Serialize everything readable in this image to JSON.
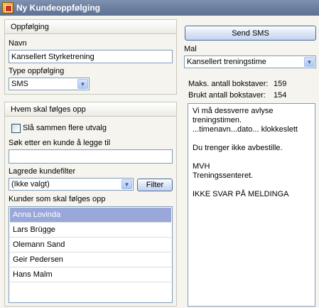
{
  "window": {
    "title": "Ny Kundeoppfølging",
    "icon": "app-icon"
  },
  "followup": {
    "header": "Oppfølging",
    "name_label": "Navn",
    "name_value": "Kansellert Styrketrening",
    "type_label": "Type oppfølging",
    "type_value": "SMS"
  },
  "who": {
    "header": "Hvem skal følges opp",
    "merge_checkbox_label": "Slå sammen flere utvalg",
    "merge_checked": false,
    "search_label": "Søk etter en kunde å legge til",
    "search_value": "",
    "saved_filter_label": "Lagrede kundefilter",
    "saved_filter_value": "(Ikke valgt)",
    "filter_button": "Filter",
    "customers_label": "Kunder som skal følges opp",
    "customers": [
      "Anna  Lovinda",
      "Lars Brügge",
      "Olemann Sand",
      "Geir Pedersen",
      "Hans Malm"
    ],
    "selected_index": 0
  },
  "sms": {
    "send_button": "Send SMS",
    "template_label": "Mal",
    "template_value": "Kansellert treningstime",
    "max_chars_label": "Maks. antall bokstaver:",
    "max_chars_value": "159",
    "used_chars_label": "Brukt antall bokstaver:",
    "used_chars_value": "154",
    "message_lines": [
      "Vi må dessverre avlyse",
      "treningstimen.",
      "...timenavn...dato... klokkeslett",
      "",
      "Du trenger ikke avbestille.",
      "",
      "MVH",
      "Treningssenteret.",
      "",
      "IKKE SVAR PÅ MELDINGA"
    ]
  }
}
